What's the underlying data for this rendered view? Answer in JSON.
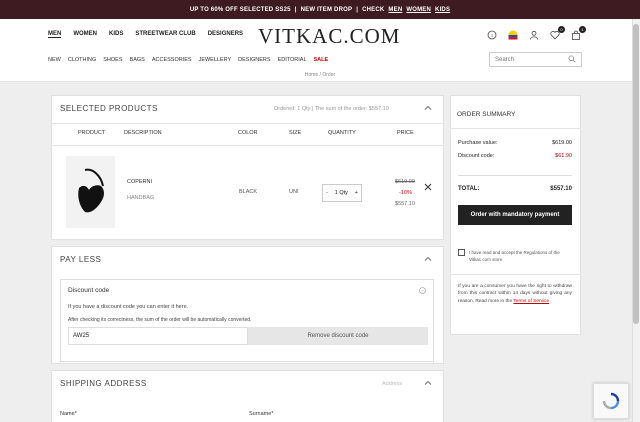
{
  "promo": {
    "part1": "UP TO 60% OFF SELECTED SS25",
    "sep1": "|",
    "part2": "NEW ITEM DROP",
    "sep2": "|",
    "part3": "CHECK",
    "link_men": "MEN",
    "link_women": "WOMEN",
    "link_kids": "KIDS"
  },
  "header": {
    "gender": [
      "MEN",
      "WOMEN",
      "KIDS",
      "STREETWEAR CLUB",
      "DESIGNERS"
    ],
    "logo": "VITKAC.COM",
    "categories": [
      "NEW",
      "CLOTHING",
      "SHOES",
      "BAGS",
      "ACCESSORIES",
      "JEWELLERY",
      "DESIGNERS",
      "EDITORIAL"
    ],
    "sale": "SALE",
    "search_placeholder": "Search",
    "wishlist_count": "0",
    "cart_count": "1"
  },
  "breadcrumb": {
    "home": "Home",
    "sep": "/",
    "current": "Order"
  },
  "selected": {
    "title": "SELECTED PRODUCTS",
    "summary": "Ordered: 1 Qty | The sum of the order: $557.10",
    "columns": [
      "PRODUCT",
      "DESCRIPTION",
      "COLOR",
      "SIZE",
      "QUANTITY",
      "PRICE"
    ],
    "item": {
      "brand": "COPERNI",
      "type": "HANDBAG",
      "color": "BLACK",
      "size": "UNI",
      "qty": "1 Qty",
      "minus": "-",
      "plus": "+",
      "old_price": "$619.00",
      "discount": "-10%",
      "price": "$557.10"
    }
  },
  "pay_less": {
    "title": "PAY LESS",
    "box_title": "Discount code",
    "line1": "If you have a discount code you can enter it here.",
    "line2": "After checking its correctness, the sum of the order will be automatically converted.",
    "code": "AW25",
    "remove_label": "Remove discount code"
  },
  "shipping": {
    "title": "SHIPPING ADDRESS",
    "addresses_label": "Address",
    "name_label": "Name*",
    "surname_label": "Surname*"
  },
  "order_summary": {
    "title": "ORDER SUMMARY",
    "purchase_label": "Purchase value:",
    "purchase_value": "$619.00",
    "discount_label": "Discount code:",
    "discount_value": "$61.90",
    "total_label": "TOTAL:",
    "total_value": "$557.10",
    "button": "Order with mandatory payment",
    "accept_text": "I have read and accept the Regulations of the Vitkac.com store.",
    "withdraw_text": "If you are a consumer you have the right to withdraw from this contract within 14 days without giving any reason. Read more in the",
    "terms_link": "Terms of Service"
  },
  "colors": {
    "promo_bg": "#3d1b21",
    "discount_red": "#c00000",
    "button_bg": "#222222"
  }
}
